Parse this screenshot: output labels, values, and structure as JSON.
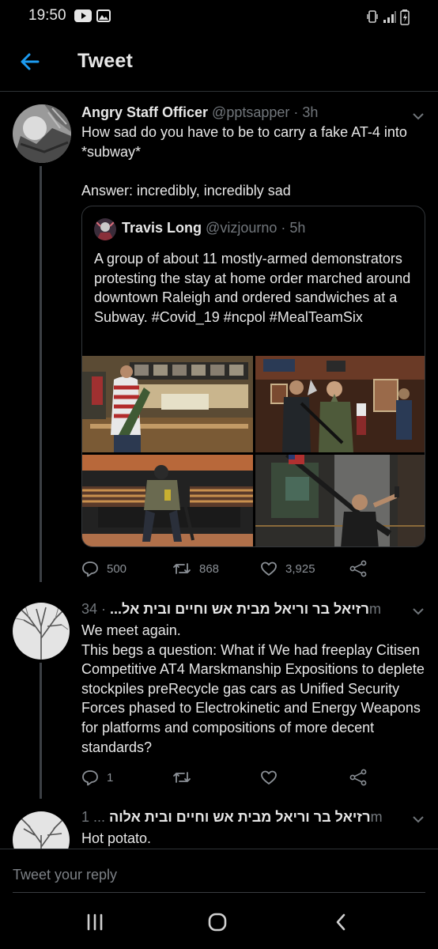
{
  "status_bar": {
    "time": "19:50",
    "icons": [
      "youtube-icon",
      "gallery-icon",
      "vibrate-icon",
      "signal-icon",
      "battery-icon"
    ]
  },
  "header": {
    "title": "Tweet",
    "back_icon": "arrow-left-icon"
  },
  "tweets": [
    {
      "name": "Angry Staff Officer",
      "handle": "@pptsapper",
      "time": "· 3h",
      "text": "How sad do you have to be to carry a fake AT-4 into *subway*\n\nAnswer: incredibly, incredibly sad",
      "quote": {
        "name": "Travis Long",
        "handle": "@vizjourno",
        "time": "· 5h",
        "text": "A group of about 11 mostly-armed demonstrators protesting the stay at home order marched around downtown Raleigh and ordered sandwiches at a Subway.  #Covid_19 #ncpol #MealTeamSix",
        "media_count": 4
      },
      "stats": {
        "replies": "500",
        "retweets": "868",
        "likes": "3,925"
      }
    },
    {
      "name": "רזיאל בר וריאל מבית אש וחיים ובית אל...",
      "time": "· 34m",
      "text": "We meet again.\nThis begs a question: What if We had freeplay Citisen Competitive AT4 Marskmanship Expositions to deplete stockpiles preRecycle gas cars as Unified Security Forces phased to Electrokinetic and Energy Weapons for platforms and compositions of more decent standards?",
      "stats": {
        "replies": "1",
        "retweets": "",
        "likes": ""
      }
    },
    {
      "name": "רזיאל בר וריאל מבית אש וחיים ובית אלוה",
      "time": "... 1m",
      "text": "Hot potato."
    }
  ],
  "reply_bar": {
    "placeholder": "Tweet your reply"
  },
  "nav": {
    "icons": [
      "recent-apps-icon",
      "home-icon",
      "back-icon"
    ]
  },
  "colors": {
    "accent": "#1d9bf0",
    "background": "#000000",
    "muted": "#71767b"
  }
}
